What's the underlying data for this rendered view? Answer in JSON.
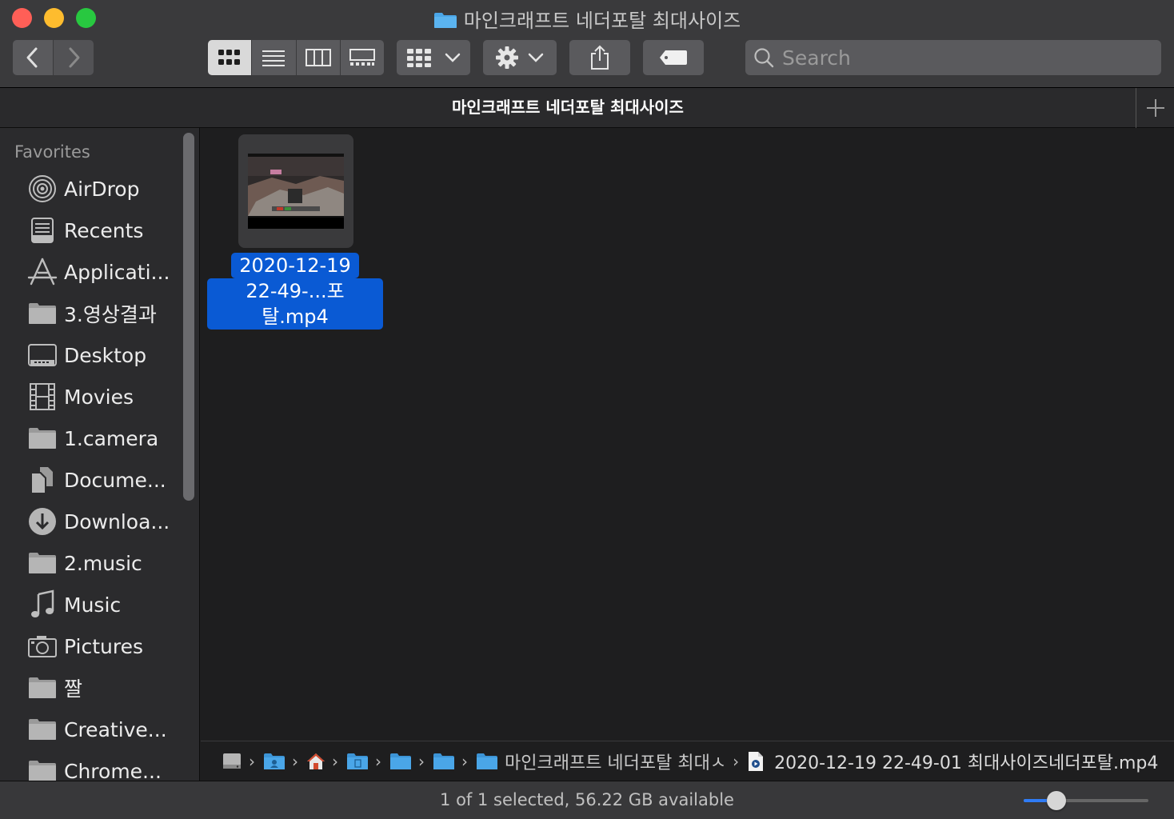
{
  "window": {
    "title": "마인크래프트 네더포탈 최대사이즈",
    "folder_icon": "folder-icon"
  },
  "toolbar": {
    "back_icon": "chevron-left-icon",
    "forward_icon": "chevron-right-icon",
    "views": [
      "icon-view",
      "list-view",
      "column-view",
      "gallery-view"
    ],
    "active_view": "icon-view",
    "group_icon": "group-grid-icon",
    "action_icon": "gear-icon",
    "share_icon": "share-icon",
    "tag_icon": "tag-icon"
  },
  "search": {
    "placeholder": "Search"
  },
  "tab": {
    "title": "마인크래프트 네더포탈 최대사이즈"
  },
  "sidebar": {
    "header": "Favorites",
    "items": [
      {
        "label": "AirDrop",
        "icon": "airdrop-icon"
      },
      {
        "label": "Recents",
        "icon": "recents-icon"
      },
      {
        "label": "Applicati...",
        "icon": "applications-icon"
      },
      {
        "label": "3.영상결과",
        "icon": "folder-icon"
      },
      {
        "label": "Desktop",
        "icon": "desktop-icon"
      },
      {
        "label": "Movies",
        "icon": "movies-icon"
      },
      {
        "label": "1.camera",
        "icon": "folder-icon"
      },
      {
        "label": "Docume...",
        "icon": "documents-icon"
      },
      {
        "label": "Downloa...",
        "icon": "downloads-icon"
      },
      {
        "label": "2.music",
        "icon": "folder-icon"
      },
      {
        "label": "Music",
        "icon": "music-icon"
      },
      {
        "label": "Pictures",
        "icon": "pictures-icon"
      },
      {
        "label": "짤",
        "icon": "folder-icon"
      },
      {
        "label": "Creative...",
        "icon": "folder-icon"
      },
      {
        "label": "Chrome...",
        "icon": "folder-icon"
      }
    ]
  },
  "files": [
    {
      "label_line1": "2020-12-19",
      "label_line2": "22-49-...포탈.mp4",
      "selected": true
    }
  ],
  "pathbar": {
    "folder_label": "마인크래프트 네더포탈 최대ㅅ",
    "file_label": "2020-12-19 22-49-01 최대사이즈네더포탈.mp4"
  },
  "status": {
    "text": "1 of 1 selected, 56.22 GB available",
    "icon_size_fraction": 0.26
  },
  "colors": {
    "selection": "#0a5ad4",
    "folder": "#4aa6e8",
    "close": "#ff5f57",
    "minimize": "#febc2e",
    "maximize": "#28c840"
  }
}
